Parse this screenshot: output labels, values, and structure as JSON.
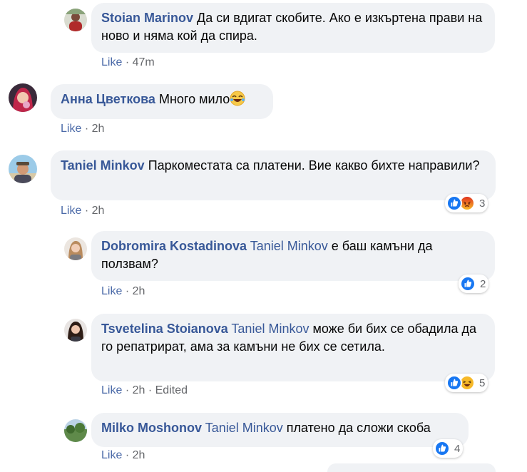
{
  "comments": [
    {
      "author": "Stoian Marinov",
      "tag": "",
      "text": "Да си вдигат скобите. Ако е изкъртена прави на ново и няма кой да спира.",
      "like_label": "Like",
      "separator": "·",
      "time": "47m",
      "edited": "",
      "reactions": null
    },
    {
      "author": "Анна Цветкова",
      "tag": "",
      "text": "Много мило",
      "emoji": "laughing-emoji",
      "like_label": "Like",
      "separator": "·",
      "time": "2h",
      "edited": "",
      "reactions": null
    },
    {
      "author": "Taniel Minkov",
      "tag": "",
      "text": "Паркоместата са платени. Вие какво бихте направили?",
      "like_label": "Like",
      "separator": "·",
      "time": "2h",
      "edited": "",
      "reactions": {
        "icons": [
          "like-reaction-icon",
          "angry-reaction-icon"
        ],
        "count": "3"
      }
    },
    {
      "author": "Dobromira Kostadinova",
      "tag": "Taniel Minkov",
      "text": "е баш камъни да ползвам?",
      "like_label": "Like",
      "separator": "·",
      "time": "2h",
      "edited": "",
      "reactions": {
        "icons": [
          "like-reaction-icon"
        ],
        "count": "2"
      }
    },
    {
      "author": "Tsvetelina Stoianova",
      "tag": "Taniel Minkov",
      "text": "може би бих се обадила да го репатрират, ама за камъни не бих се сетила.",
      "like_label": "Like",
      "separator": "·",
      "time": "2h",
      "edited": "Edited",
      "reactions": {
        "icons": [
          "like-reaction-icon",
          "haha-reaction-icon"
        ],
        "count": "5"
      }
    },
    {
      "author": "Milko Moshonov",
      "tag": "Taniel Minkov",
      "text": "платено да сложи скоба",
      "like_label": "Like",
      "separator": "·",
      "time": "2h",
      "edited": "",
      "reactions": {
        "icons": [
          "like-reaction-icon"
        ],
        "count": "4"
      }
    }
  ],
  "colors": {
    "bubble": "#f0f2f5",
    "author": "#385898",
    "like_blue": "#1877f2",
    "angry": "#e9710f",
    "haha": "#f7b928"
  }
}
